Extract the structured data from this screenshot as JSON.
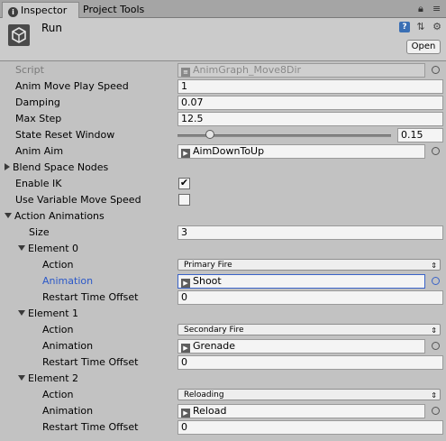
{
  "tabs": {
    "inspector": "Inspector",
    "project_tools": "Project Tools"
  },
  "header": {
    "title": "Run",
    "open_label": "Open"
  },
  "fields": {
    "script": {
      "label": "Script",
      "value": "AnimGraph_Move8Dir"
    },
    "anim_move_play_speed": {
      "label": "Anim Move Play Speed",
      "value": "1"
    },
    "damping": {
      "label": "Damping",
      "value": "0.07"
    },
    "max_step": {
      "label": "Max Step",
      "value": "12.5"
    },
    "state_reset_window": {
      "label": "State Reset Window",
      "value": "0.15",
      "slider_fraction": 0.15
    },
    "anim_aim": {
      "label": "Anim Aim",
      "value": "AimDownToUp"
    },
    "blend_space_nodes": {
      "label": "Blend Space Nodes"
    },
    "enable_ik": {
      "label": "Enable IK",
      "checked": true
    },
    "use_variable_move_speed": {
      "label": "Use Variable Move Speed",
      "checked": false
    }
  },
  "action_animations": {
    "label": "Action Animations",
    "size_label": "Size",
    "size": "3",
    "action_label": "Action",
    "animation_label": "Animation",
    "restart_label": "Restart Time Offset",
    "elements": [
      {
        "label": "Element 0",
        "action": "Primary Fire",
        "animation": "Shoot",
        "restart": "0"
      },
      {
        "label": "Element 1",
        "action": "Secondary Fire",
        "animation": "Grenade",
        "restart": "0"
      },
      {
        "label": "Element 2",
        "action": "Reloading",
        "animation": "Reload",
        "restart": "0"
      }
    ]
  },
  "icons": {
    "tab_info": "info-icon",
    "lock": "lock-icon",
    "menu": "menu-icon",
    "component": "unity-logo-icon",
    "help": "help-icon",
    "preset": "preset-icon",
    "gear": "gear-icon",
    "object_picker": "object-picker-icon"
  },
  "colors": {
    "background": "#c2c2c2",
    "focused_label": "#2b58c8",
    "help_icon": "#3a6fb4"
  }
}
